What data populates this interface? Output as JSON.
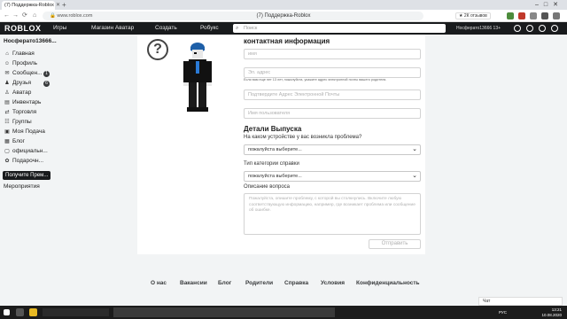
{
  "browser": {
    "tab_title": "(7) Поддержка-Roblox",
    "close_glyph": "✕",
    "new_tab_glyph": "+",
    "window_controls": "–□✕",
    "url": "www.roblox.com",
    "page_title": "(7) Поддержка-Roblox",
    "reviews": "★ 2К отзывов"
  },
  "header": {
    "logo": "ROBLOX",
    "nav": [
      "Игры",
      "Магазин Аватар",
      "Создать",
      "Робукс"
    ],
    "search_placeholder": "Поиск",
    "username": "Hocферато13666 13+"
  },
  "sidebar": {
    "username": "Hocферато13666...",
    "items": [
      {
        "icon": "⌂",
        "label": "Главная",
        "badge": ""
      },
      {
        "icon": "☺",
        "label": "Профиль",
        "badge": ""
      },
      {
        "icon": "✉",
        "label": "Сообщен...",
        "badge": "1"
      },
      {
        "icon": "♟",
        "label": "Друзья",
        "badge": "6"
      },
      {
        "icon": "♙",
        "label": "Аватар",
        "badge": ""
      },
      {
        "icon": "▤",
        "label": "Инвентарь",
        "badge": ""
      },
      {
        "icon": "⇄",
        "label": "Торговля",
        "badge": ""
      },
      {
        "icon": "☷",
        "label": "Группы",
        "badge": ""
      },
      {
        "icon": "▣",
        "label": "Моя Подача",
        "badge": ""
      },
      {
        "icon": "▦",
        "label": "Блог",
        "badge": ""
      },
      {
        "icon": "▢",
        "label": "официальн...",
        "badge": ""
      },
      {
        "icon": "✿",
        "label": "Подарочн...",
        "badge": ""
      }
    ],
    "premium_button": "Получите Прем...",
    "events": "Мероприятия"
  },
  "form": {
    "contact_title": "контактная информация",
    "name_placeholder": "имя",
    "email_placeholder": "Эл. адрес",
    "email_hint": "Если вам еще нет 13 лет, пожалуйста, укажите адрес электронной почты вашего родителя.",
    "confirm_email_placeholder": "Подтвердите Адрес Электронной Почты",
    "username_placeholder": "Имя пользователя",
    "issue_title": "Детали Выпуска",
    "device_label": "На каком устройстве у вас возникла проблема?",
    "device_value": "пожалуйста выберите...",
    "category_label": "Тип категории справки",
    "category_value": "пожалуйста выберите...",
    "description_label": "Описание вопроса",
    "description_placeholder": "Пожалуйста, опишите проблему, с которой вы столкнулись. Включите любую соответствующую информацию, например, где возникает проблема или сообщение об ошибке.",
    "submit": "Отправить"
  },
  "footer": {
    "links": [
      "О нас",
      "Вакансии",
      "Блог",
      "Родители",
      "Справка",
      "Условия",
      "Конфиденциальность"
    ]
  },
  "chat": "Чат",
  "taskbar": {
    "lang": "РУС",
    "time": "13:21",
    "date": "10.08.2020"
  }
}
